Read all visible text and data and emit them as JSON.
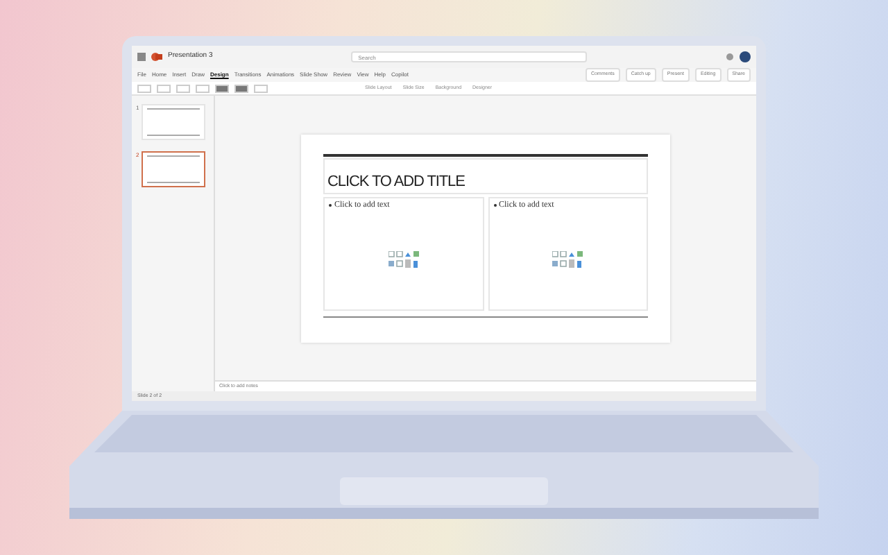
{
  "app": {
    "title": "Presentation 3",
    "search": {
      "placeholder": "Search"
    }
  },
  "menu": [
    {
      "label": "File",
      "selected": false
    },
    {
      "label": "Home",
      "selected": false
    },
    {
      "label": "Insert",
      "selected": false
    },
    {
      "label": "Draw",
      "selected": false
    },
    {
      "label": "Design",
      "selected": true
    },
    {
      "label": "Transitions",
      "selected": false
    },
    {
      "label": "Animations",
      "selected": false
    },
    {
      "label": "Slide Show",
      "selected": false
    },
    {
      "label": "Review",
      "selected": false
    },
    {
      "label": "View",
      "selected": false
    },
    {
      "label": "Help",
      "selected": false
    },
    {
      "label": "Copilot",
      "selected": false
    }
  ],
  "actions": [
    "Comments",
    "Catch up",
    "Present",
    "Editing",
    "Share"
  ],
  "ribbon_buttons": [
    "Slide Layout",
    "Slide Size",
    "Background",
    "Designer"
  ],
  "thumbnails": [
    {
      "number": "1",
      "selected": false
    },
    {
      "number": "2",
      "selected": true
    }
  ],
  "slide": {
    "title": "CLICK TO ADD TITLE",
    "placeholders": [
      "Click to add text",
      "Click to add text"
    ]
  },
  "notes": {
    "placeholder": "Click to add notes"
  },
  "status_bar": {
    "slide": "Slide 2 of 2"
  }
}
